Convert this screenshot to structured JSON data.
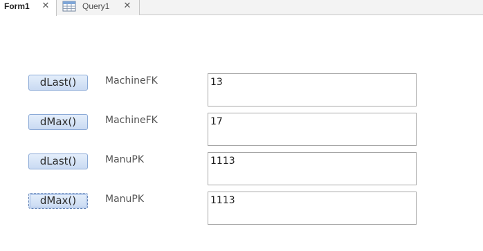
{
  "tabs": [
    {
      "label": "Form1",
      "close": "✕",
      "icon": "form-icon"
    },
    {
      "label": "Query1",
      "close": "✕",
      "icon": "query-datasheet-icon"
    }
  ],
  "rows": [
    {
      "button_label": "dLast()",
      "field_label": "MachineFK",
      "value": "13"
    },
    {
      "button_label": "dMax()",
      "field_label": "MachineFK",
      "value": "17"
    },
    {
      "button_label": "dLast()",
      "field_label": "ManuPK",
      "value": "1113"
    },
    {
      "button_label": "dMax()",
      "field_label": "ManuPK",
      "value": "1113"
    }
  ]
}
